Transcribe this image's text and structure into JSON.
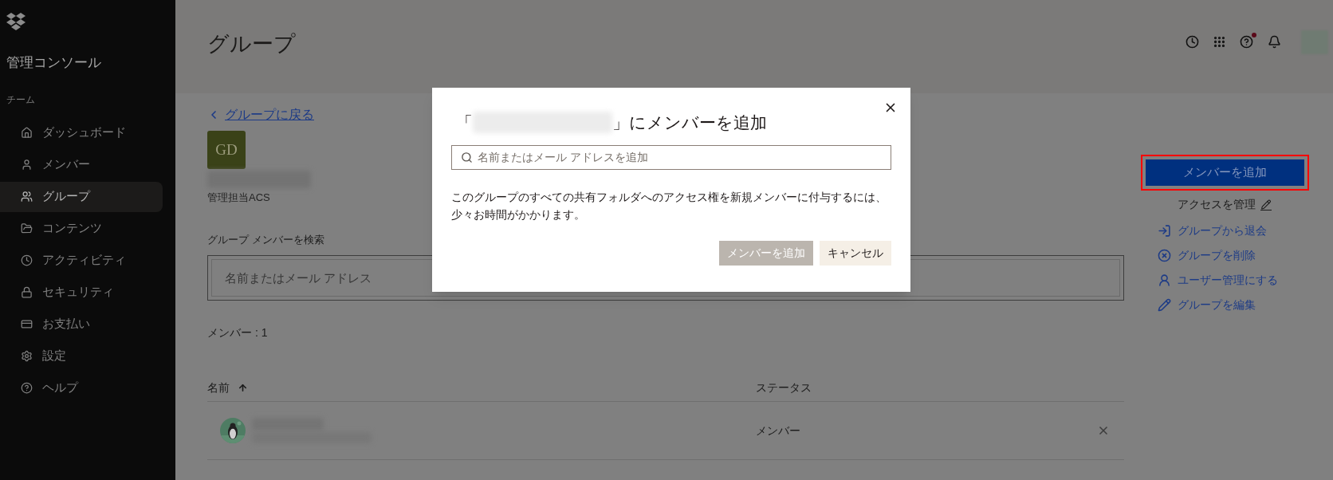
{
  "sidebar": {
    "brand": "管理コンソール",
    "section": "チーム",
    "items": [
      {
        "label": "ダッシュボード",
        "selected": false
      },
      {
        "label": "メンバー",
        "selected": false
      },
      {
        "label": "グループ",
        "selected": true
      },
      {
        "label": "コンテンツ",
        "selected": false
      },
      {
        "label": "アクティビティ",
        "selected": false
      },
      {
        "label": "セキュリティ",
        "selected": false
      },
      {
        "label": "お支払い",
        "selected": false
      },
      {
        "label": "設定",
        "selected": false
      },
      {
        "label": "ヘルプ",
        "selected": false
      }
    ]
  },
  "header": {
    "title": "グループ",
    "help_badge": true
  },
  "back_link": "グループに戻る",
  "group": {
    "initials": "GD",
    "role": "管理担当ACS"
  },
  "member_search": {
    "label": "グループ メンバーを検索",
    "placeholder": "名前またはメール アドレス"
  },
  "member_count": "メンバー : 1",
  "table": {
    "columns": [
      {
        "label": "名前",
        "sorted": true
      },
      {
        "label": "ステータス",
        "sorted": false
      }
    ],
    "rows": [
      {
        "status": "メンバー"
      }
    ]
  },
  "actions": {
    "primary": {
      "label": "メンバーを追加",
      "highlighted": true
    },
    "manage_access": "アクセスを管理",
    "links": [
      "グループから退会",
      "グループを削除",
      "ユーザー管理にする",
      "グループを編集"
    ]
  },
  "dialog": {
    "title_prefix": "「",
    "title_suffix": "」にメンバーを追加",
    "search_placeholder": "名前またはメール アドレスを追加",
    "message": "このグループのすべての共有フォルダへのアクセス権を新規メンバーに付与するには、少々お時間がかかります。",
    "buttons": [
      {
        "label": "メンバーを追加",
        "disabled": true
      },
      {
        "label": "キャンセル",
        "disabled": false
      }
    ]
  }
}
